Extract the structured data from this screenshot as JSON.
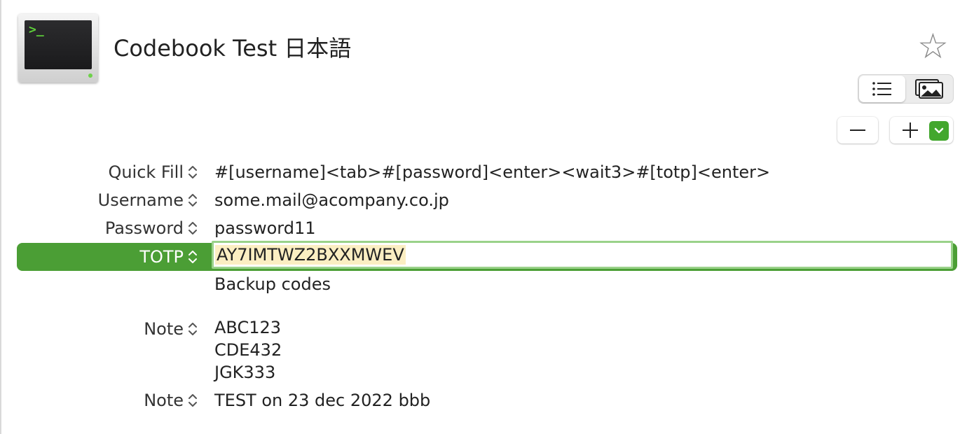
{
  "header": {
    "title": "Codebook Test 日本語",
    "app_icon_prompt": ">_",
    "favorite_icon": "star-outline-icon"
  },
  "view_switcher": {
    "options": [
      {
        "icon": "list-icon",
        "selected": true
      },
      {
        "icon": "gallery-icon",
        "selected": false
      }
    ]
  },
  "actions": {
    "remove_icon": "minus-icon",
    "add_icon": "plus-icon",
    "add_menu_icon": "chevron-down-icon",
    "accent_color": "#43a72d"
  },
  "fields": [
    {
      "label": "Quick Fill",
      "value": "#[username]<tab>#[password]<enter><wait3>#[totp]<enter>"
    },
    {
      "label": "Username",
      "value": "some.mail@acompany.co.jp"
    },
    {
      "label": "Password",
      "value": "password11"
    },
    {
      "label": "TOTP",
      "value": "AY7IMTWZ2BXXMWEV",
      "selected": true
    },
    {
      "label": "",
      "value": "Backup codes"
    },
    {
      "label": "Note",
      "lines": [
        "ABC123",
        "CDE432",
        "JGK333"
      ]
    },
    {
      "label": "Note",
      "value": "TEST on 23 dec 2022 bbb"
    }
  ],
  "colors": {
    "selection_row": "#4b9e35",
    "text_highlight": "#fbeec2"
  }
}
